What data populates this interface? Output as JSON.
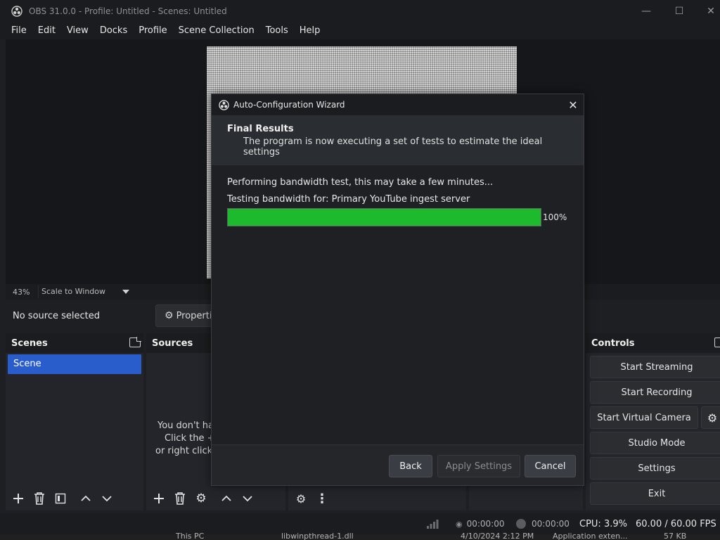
{
  "window": {
    "title": "OBS 31.0.0 - Profile: Untitled - Scenes: Untitled",
    "minimize": "—",
    "maximize": "☐",
    "close": "✕"
  },
  "menu": [
    "File",
    "Edit",
    "View",
    "Docks",
    "Profile",
    "Scene Collection",
    "Tools",
    "Help"
  ],
  "preview": {
    "zoom": "43%",
    "scale_mode": "Scale to Window"
  },
  "source_bar": {
    "no_source": "No source selected",
    "properties_label": "Properti"
  },
  "scenes": {
    "title": "Scenes",
    "items": [
      "Scene"
    ]
  },
  "sources": {
    "title": "Sources",
    "empty_line1": "You don't ha",
    "empty_line2": "Click the + b",
    "empty_line3": "or right click h"
  },
  "controls": {
    "title": "Controls",
    "start_streaming": "Start Streaming",
    "start_recording": "Start Recording",
    "start_virtual_camera": "Start Virtual Camera",
    "studio_mode": "Studio Mode",
    "settings": "Settings",
    "exit": "Exit"
  },
  "status": {
    "stream_time": "00:00:00",
    "record_time": "00:00:00",
    "cpu": "CPU: 3.9%",
    "fps": "60.00 / 60.00 FPS"
  },
  "taskbar": {
    "item1": "This PC",
    "item2": "libwinpthread-1.dll",
    "item3": "4/10/2024 2:12 PM",
    "item4": "Application exten...",
    "item5": "57 KB"
  },
  "wizard": {
    "title": "Auto-Configuration Wizard",
    "close": "✕",
    "header_title": "Final Results",
    "header_subtitle": "The program is now executing a set of tests to estimate the ideal settings",
    "line1": "Performing bandwidth test, this may take a few minutes...",
    "line2": "Testing bandwidth for: Primary YouTube ingest server",
    "progress": 100,
    "progress_label": "100%",
    "back": "Back",
    "apply": "Apply Settings",
    "cancel": "Cancel"
  },
  "colors": {
    "accent": "#2a5dcc",
    "progress": "#1cba2c"
  }
}
